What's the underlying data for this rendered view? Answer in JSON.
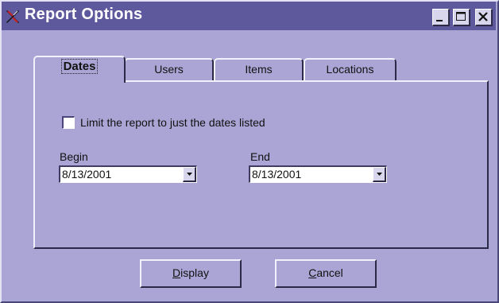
{
  "window": {
    "title": "Report Options",
    "controls": {
      "minimize_icon": "minimize-icon",
      "maximize_icon": "maximize-icon",
      "close_icon": "close-icon"
    }
  },
  "colors": {
    "titlebar": "#5e589c",
    "window_bg": "#aaa5d5",
    "title_text": "#ffffff"
  },
  "tabs": [
    {
      "label": "Dates",
      "active": true
    },
    {
      "label": "Users",
      "active": false
    },
    {
      "label": "Items",
      "active": false
    },
    {
      "label": "Locations",
      "active": false
    }
  ],
  "dates_panel": {
    "limit_checkbox": {
      "label": "Limit the report to just the dates listed",
      "checked": false
    },
    "begin": {
      "label": "Begin",
      "value": "8/13/2001"
    },
    "end": {
      "label": "End",
      "value": "8/13/2001"
    }
  },
  "buttons": {
    "display": {
      "mnemonic": "D",
      "rest": "isplay"
    },
    "cancel": {
      "mnemonic": "C",
      "rest": "ancel"
    }
  }
}
